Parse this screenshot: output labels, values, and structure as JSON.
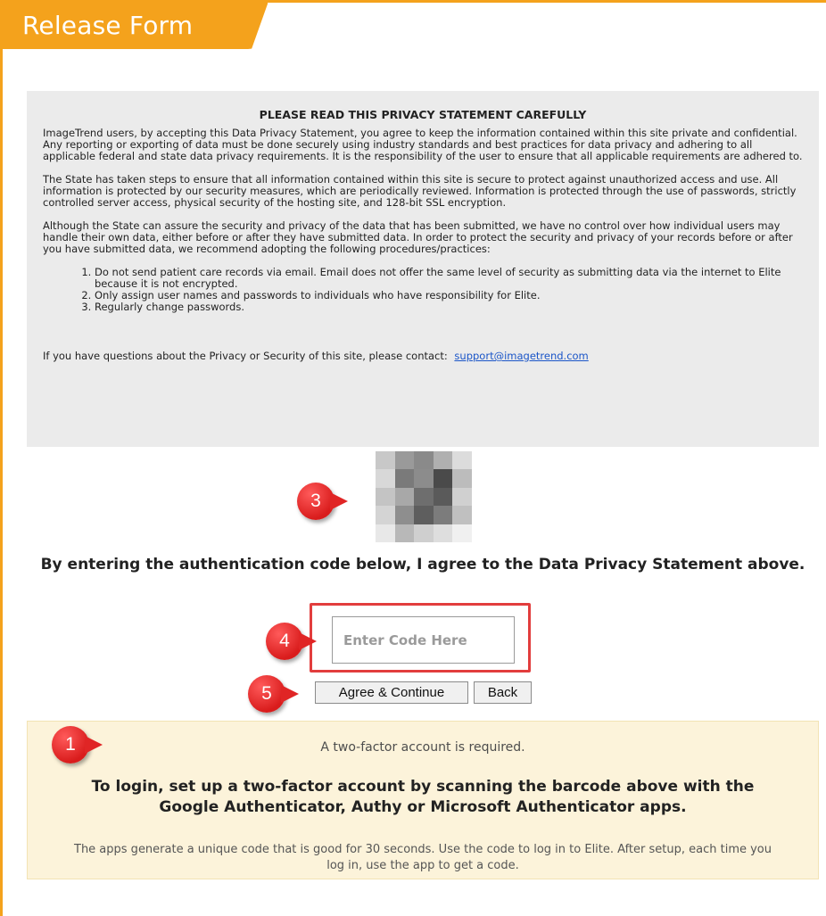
{
  "header": {
    "title": "Release Form"
  },
  "privacy": {
    "heading": "PLEASE READ THIS PRIVACY STATEMENT CAREFULLY",
    "paragraph1": "ImageTrend users, by accepting this Data Privacy Statement, you agree to keep the information contained within this site private and confidential. Any reporting or exporting of data must be done securely using industry standards and best practices for data privacy and adhering to all applicable federal and state data privacy requirements. It is the responsibility of the user to ensure that all applicable requirements are adhered to.",
    "paragraph2": "The State has taken steps to ensure that all information contained within this site is secure to protect against unauthorized access and use. All information is protected by our security measures, which are periodically reviewed. Information is protected through the use of passwords, strictly controlled server access, physical security of the hosting site, and 128-bit SSL encryption.",
    "paragraph3": "Although the State can assure the security and privacy of the data that has been submitted, we have no control over how individual users may handle their own data, either before or after they have submitted data. In order to protect the security and privacy of your records before or after you have submitted data, we recommend adopting the following procedures/practices:",
    "list": [
      "Do not send patient care records via email. Email does not offer the same level of security as submitting data via the internet to Elite because it is not encrypted.",
      "Only assign user names and passwords to individuals who have responsibility for Elite.",
      "Regularly change passwords."
    ],
    "contact_text": "If you have questions about the Privacy or Security of this site, please contact:",
    "contact_email": "support@imagetrend.com"
  },
  "auth": {
    "agree_text": "By entering the authentication code below, I agree to the Data Privacy Statement above.",
    "code_placeholder": "Enter Code Here",
    "agree_button": "Agree & Continue",
    "back_button": "Back"
  },
  "notice": {
    "line1": "A two-factor account is required.",
    "line2": "To login, set up a two-factor account by scanning the barcode above with the Google Authenticator, Authy or Microsoft Authenticator apps.",
    "line3": "The apps generate a unique code that is good for 30 seconds. Use the code to log in to Elite. After setup, each time you log in, use the app to get a code."
  },
  "callouts": {
    "c1": "1",
    "c3": "3",
    "c4": "4",
    "c5": "5"
  },
  "colors": {
    "accent": "#f4a21c",
    "callout": "#e02525",
    "notice_bg": "#fcf3da",
    "privacy_bg": "#ebebeb",
    "link": "#1a55c8"
  },
  "qr_cells": [
    "#c8c8c8",
    "#9a9a9a",
    "#8a8a8a",
    "#b0b0b0",
    "#dcdcdc",
    "#d8d8d8",
    "#7a7a7a",
    "#8c8c8c",
    "#4a4a4a",
    "#bcbcbc",
    "#c4c4c4",
    "#a8a8a8",
    "#6e6e6e",
    "#5a5a5a",
    "#d0d0d0",
    "#d4d4d4",
    "#8e8e8e",
    "#5e5e5e",
    "#7c7c7c",
    "#c0c0c0",
    "#e8e8e8",
    "#b8b8b8",
    "#cfcfcf",
    "#dedede",
    "#f0f0f0"
  ]
}
